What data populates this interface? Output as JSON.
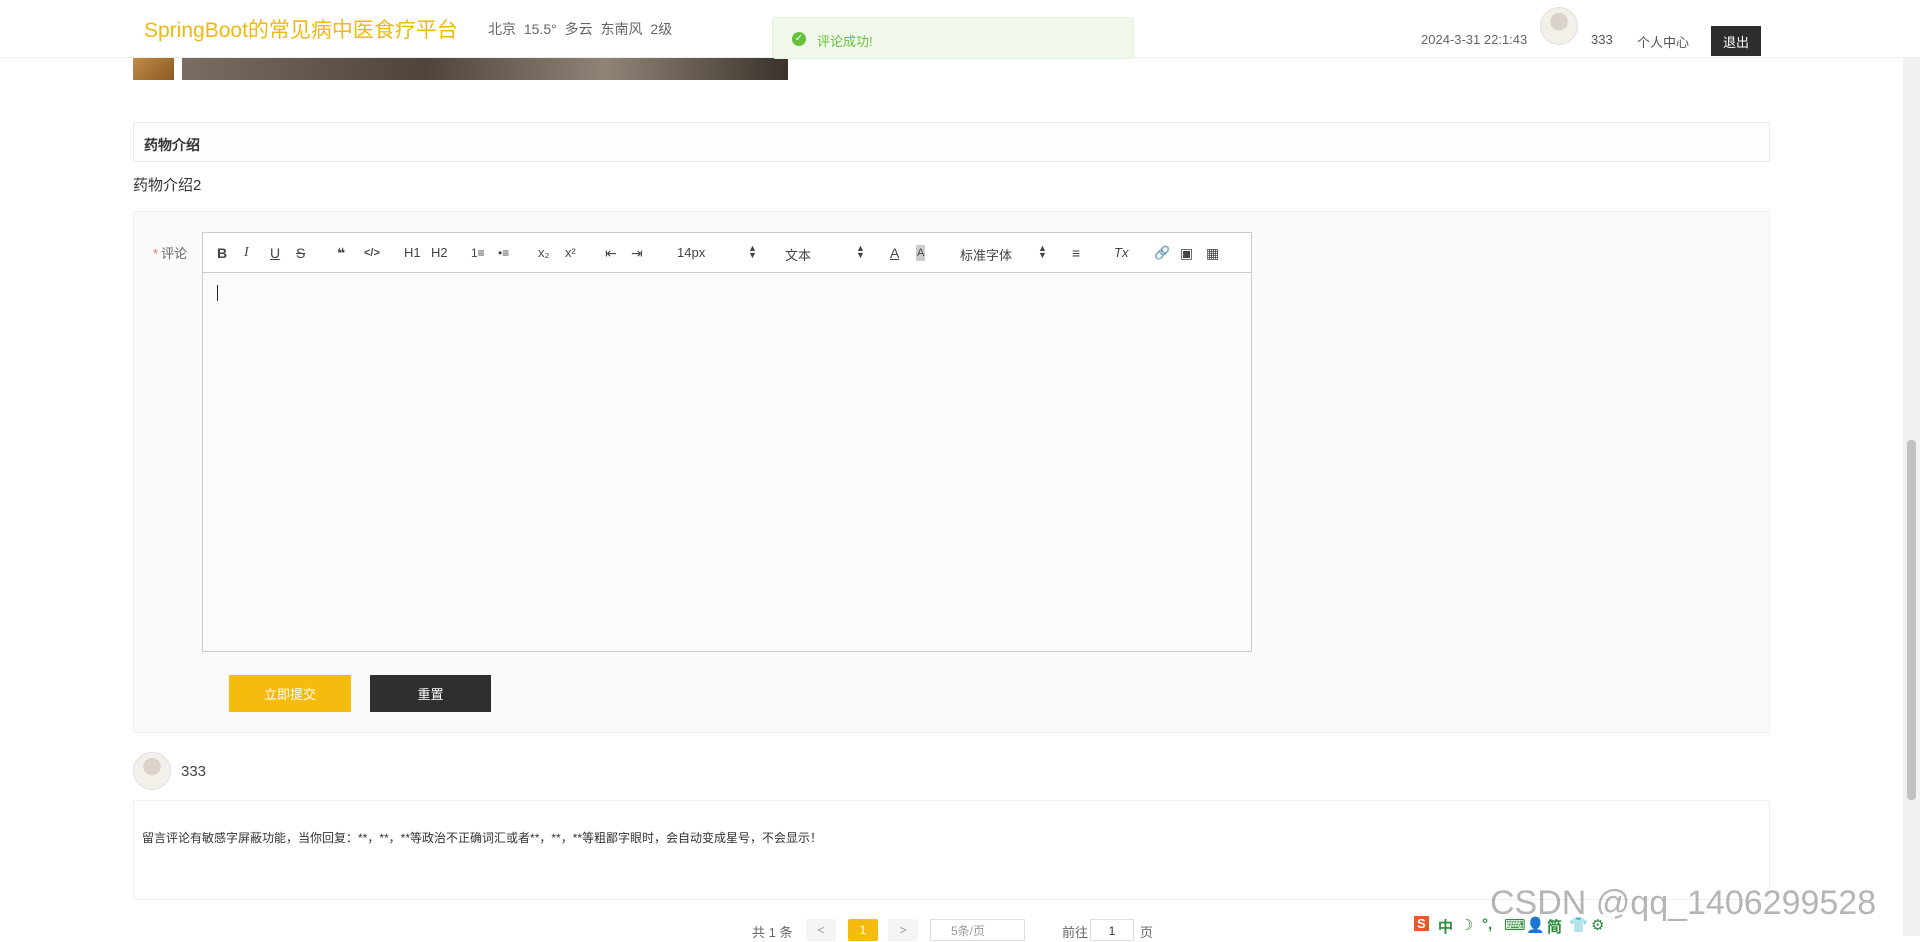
{
  "header": {
    "site_title": "SpringBoot的常见病中医食疗平台",
    "weather": "北京 15.5° 多云 东南风 2级",
    "datetime": "2024-3-31 22:1:43",
    "username": "333",
    "center_link": "个人中心",
    "logout_label": "退出"
  },
  "toast": {
    "icon": "check-circle-icon",
    "message": "评论成功!",
    "color": "#67c23a"
  },
  "detail": {
    "section_title": "药物介绍",
    "description": "药物介绍2"
  },
  "comment_form": {
    "label_required_mark": "*",
    "label": "评论",
    "toolbar": {
      "bold": "B",
      "italic": "I",
      "underline": "U",
      "strike": "S",
      "blockquote": "❝",
      "code": "</>",
      "h1": "H1",
      "h2": "H2",
      "ordered_list": "1≡",
      "bullet_list": "•≡",
      "subscript": "x₂",
      "superscript": "x²",
      "outdent": "⇤",
      "indent": "⇥",
      "size_select": "14px",
      "header_select": "文本",
      "font_color": "A",
      "background_color": "A",
      "font_select": "标准字体",
      "align": "≡",
      "clean": "Tx",
      "link": "🔗",
      "image": "▣",
      "video": "▦"
    },
    "submit_label": "立即提交",
    "reset_label": "重置",
    "accent_color": "#f5bb0f"
  },
  "comments": [
    {
      "username": "333",
      "content": "留言评论有敏感字屏蔽功能，当你回复：**，**，**等政治不正确词汇或者**，**，**等粗鄙字眼时，会自动变成星号，不会显示！"
    }
  ],
  "pagination": {
    "total": "共 1 条",
    "prev": "<",
    "current_page": "1",
    "next": ">",
    "page_size": "5条/页",
    "goto_label": "前往",
    "goto_value": "1",
    "page_unit": "页"
  },
  "watermark": "CSDN @qq_1406299528",
  "ime": {
    "logo": "S",
    "lang": "中",
    "moon": "☽",
    "punct": "°,",
    "keyboard": "⌨",
    "user": "👤",
    "simplified": "简",
    "shirt": "👕",
    "settings": "⚙"
  }
}
